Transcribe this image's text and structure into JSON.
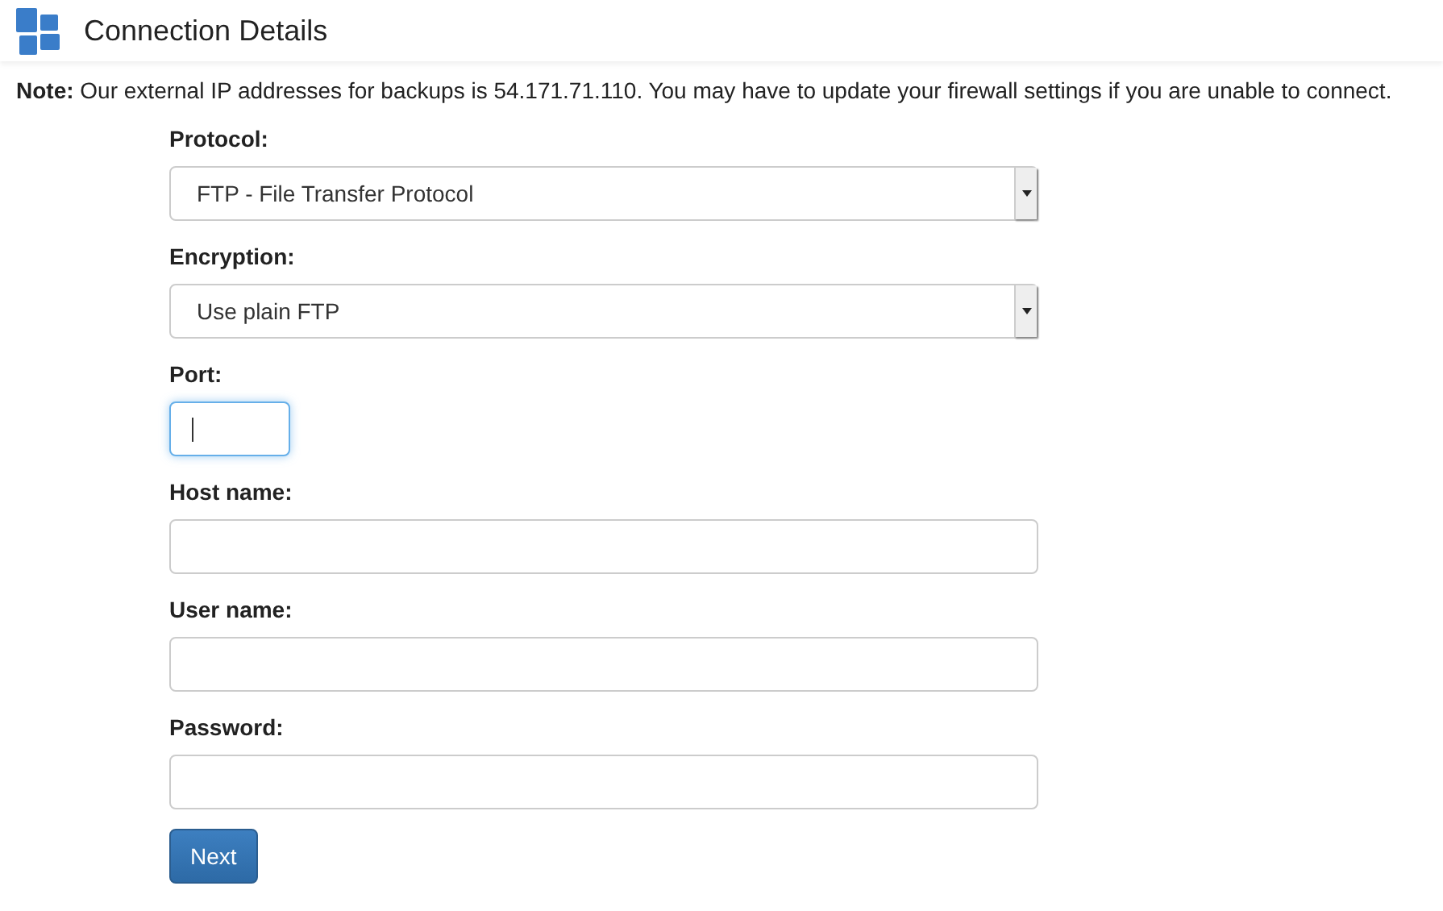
{
  "header": {
    "title": "Connection Details"
  },
  "note": "**Note:** Our external IP addresses for backups is 54.171.71.110. You may have to update your firewall settings if you are unable to connect.",
  "fields": [
    {
      "kind": "select",
      "label": "Protocol:",
      "value": "FTP - File Transfer Protocol"
    },
    {
      "kind": "select",
      "label": "Encryption:",
      "value": "Use plain FTP"
    },
    {
      "kind": "short_input",
      "label": "Port:",
      "focused": true
    },
    {
      "kind": "input",
      "label": "Host name:",
      "focused": false
    },
    {
      "kind": "input",
      "label": "User name:",
      "focused": false
    },
    {
      "kind": "input",
      "label": "Password:",
      "focused": false
    }
  ],
  "button": "Next"
}
